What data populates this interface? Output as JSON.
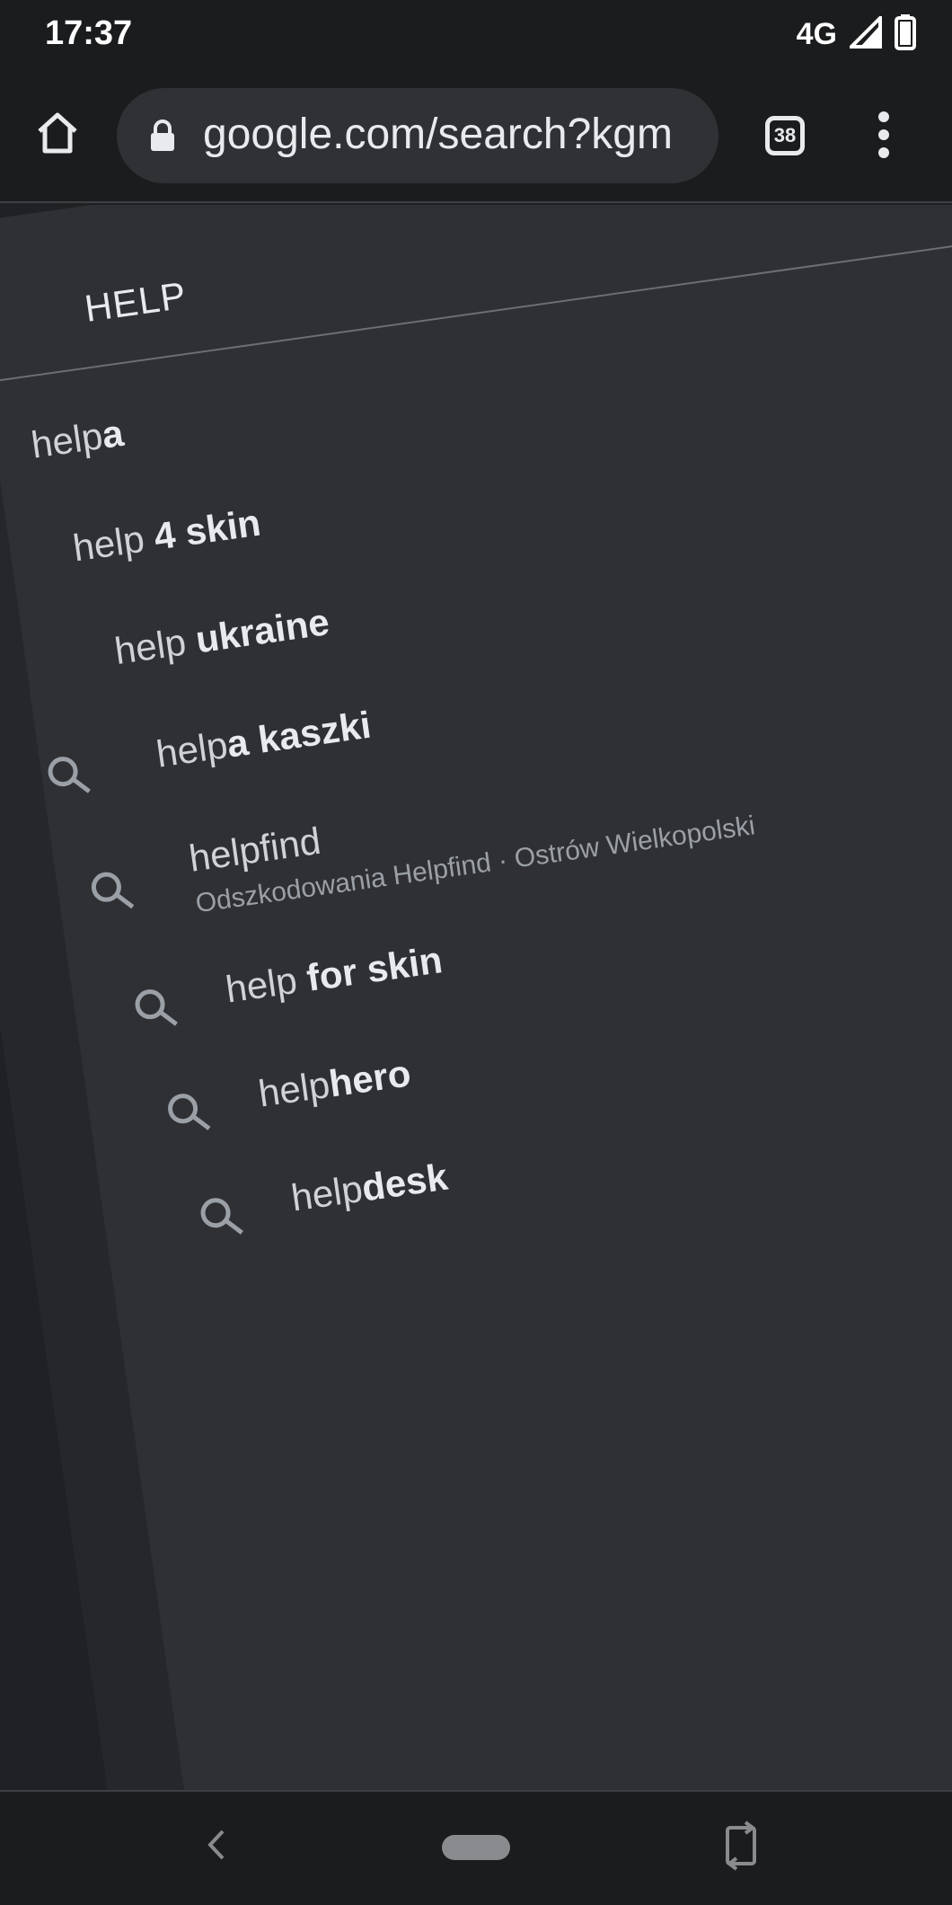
{
  "status_bar": {
    "time": "17:37",
    "network": "4G",
    "icons": [
      "signal-icon",
      "battery-icon"
    ]
  },
  "toolbar": {
    "url": "google.com/search?kgm",
    "tab_count": "38",
    "icons": [
      "home-icon",
      "lock-icon",
      "tab-switcher-icon",
      "overflow-menu-icon"
    ]
  },
  "search": {
    "query": "HELP"
  },
  "suggestions": [
    {
      "prefix": "help",
      "bold": "a",
      "sub": ""
    },
    {
      "prefix": "help ",
      "bold": "4 skin",
      "sub": ""
    },
    {
      "prefix": "help ",
      "bold": "ukraine",
      "sub": ""
    },
    {
      "prefix": "help",
      "bold": "a kaszki",
      "sub": ""
    },
    {
      "prefix": "helpfind",
      "bold": "",
      "sub": "Odszkodowania Helpfind · Ostrów Wielkopolski"
    },
    {
      "prefix": "help ",
      "bold": "for skin",
      "sub": ""
    },
    {
      "prefix": "help",
      "bold": "hero",
      "sub": ""
    },
    {
      "prefix": "help",
      "bold": "desk",
      "sub": ""
    }
  ],
  "nav_bar": {
    "icons": [
      "back-icon",
      "home-pill-icon",
      "rotate-icon"
    ]
  },
  "colors": {
    "background": "#202124",
    "panel": "#2f3034",
    "text_primary": "#e8eaed",
    "text_secondary": "#9aa0a6"
  }
}
